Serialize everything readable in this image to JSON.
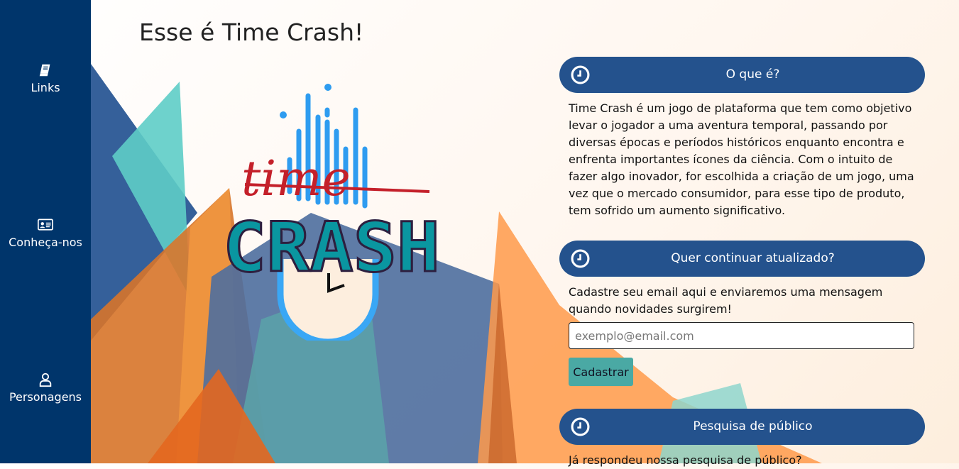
{
  "nav": {
    "items": [
      {
        "label": "Links",
        "icon": "book-icon"
      },
      {
        "label": "Conheça-nos",
        "icon": "id-card-icon"
      },
      {
        "label": "Personagens",
        "icon": "user-icon"
      }
    ]
  },
  "page": {
    "title": "Esse é Time Crash!"
  },
  "logo": {
    "word_top": "time",
    "word_bottom": "CRASH"
  },
  "sections": [
    {
      "header": "O que é?",
      "icon": "clock-icon",
      "text": "Time Crash é um jogo de plataforma que tem como objetivo levar o jogador a uma aventura temporal, passando por diversas épocas e períodos históricos enquanto encontra e enfrenta importantes ícones da ciência. Com o intuito de fazer algo inovador, for escolhida a criação de um jogo, uma vez que o mercado consumidor, para esse tipo de produto, tem sofrido um aumento significativo."
    },
    {
      "header": "Quer continuar atualizado?",
      "icon": "clock-icon",
      "text": "Cadastre seu email aqui e enviaremos uma mensagem quando novidades surgirem!"
    },
    {
      "header": "Pesquisa de público",
      "icon": "clock-icon",
      "text": "Já respondeu nossa pesquisa de público?"
    }
  ],
  "signup": {
    "placeholder": "exemplo@email.com",
    "value": "",
    "button_label": "Cadastrar"
  },
  "colors": {
    "sidebar": "#00356b",
    "pill": "#24528d",
    "button": "#4aa9a4",
    "teal": "#5ecdc6",
    "orange": "#ff9a4a",
    "navy": "#34588f"
  }
}
